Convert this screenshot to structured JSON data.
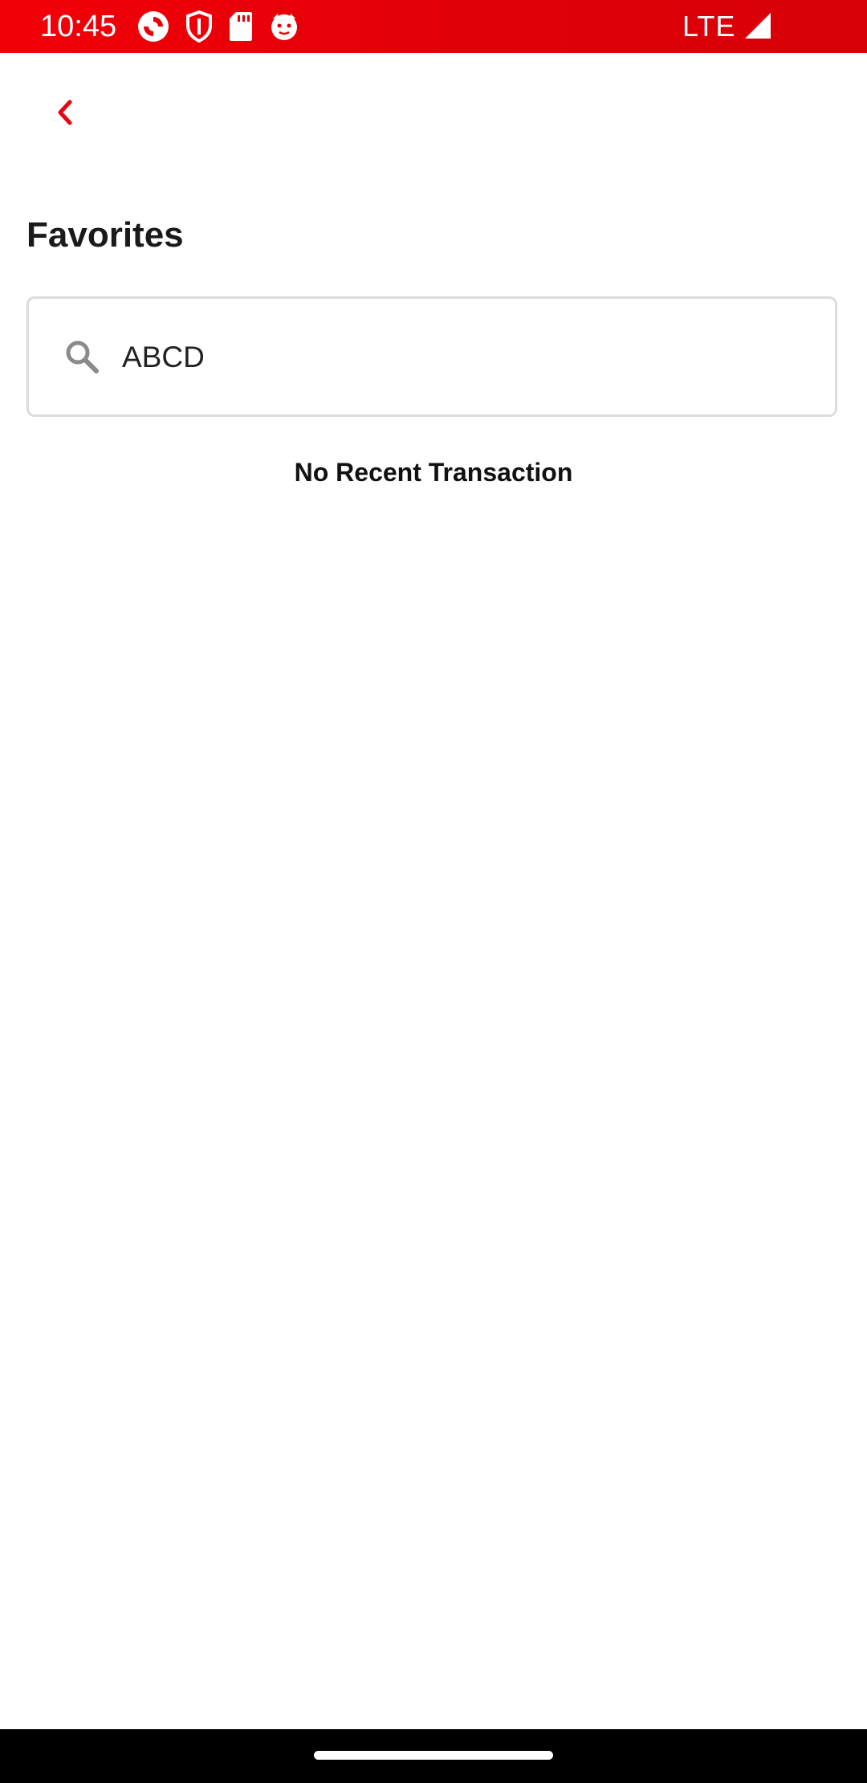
{
  "status_bar": {
    "time": "10:45",
    "network": "LTE",
    "icons": [
      "app-sync-icon",
      "shield-icon",
      "sd-card-icon",
      "cat-face-icon",
      "signal-icon"
    ],
    "background_color": "#e60008"
  },
  "header": {
    "back_icon": "chevron-left-icon",
    "accent_color": "#e30613"
  },
  "page": {
    "title": "Favorites"
  },
  "search": {
    "value": "ABCD",
    "icon": "search-icon"
  },
  "empty_state": {
    "message": "No Recent Transaction"
  }
}
